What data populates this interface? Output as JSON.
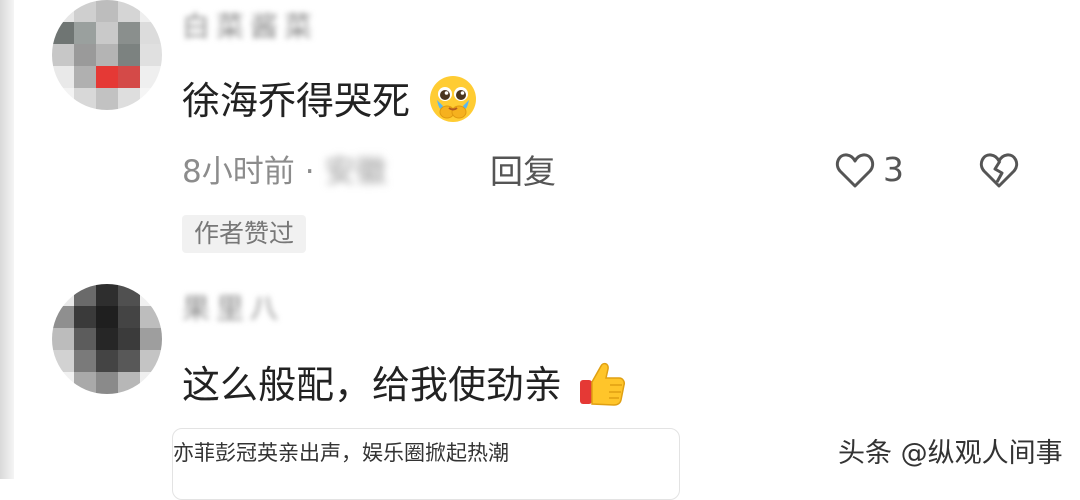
{
  "comments": [
    {
      "username": "白菜酱菜",
      "text": "徐海乔得哭死",
      "emoji": "pleading-face-emoji",
      "time": "8小时前",
      "separator": "·",
      "location": "安徽",
      "reply_label": "回复",
      "like_count": "3",
      "badge": "作者赞过"
    },
    {
      "username": "果里八",
      "text": "这么般配，给我使劲亲",
      "emoji": "thumbs-up-emoji"
    }
  ],
  "preview_card": {
    "text": "亦菲彭冠英亲出声，娱乐圈掀起热潮"
  },
  "watermark": "头条 @纵观人间事",
  "colors": {
    "meta": "#8c8c8c",
    "badge_bg": "#f1f1f1",
    "text": "#222222"
  }
}
